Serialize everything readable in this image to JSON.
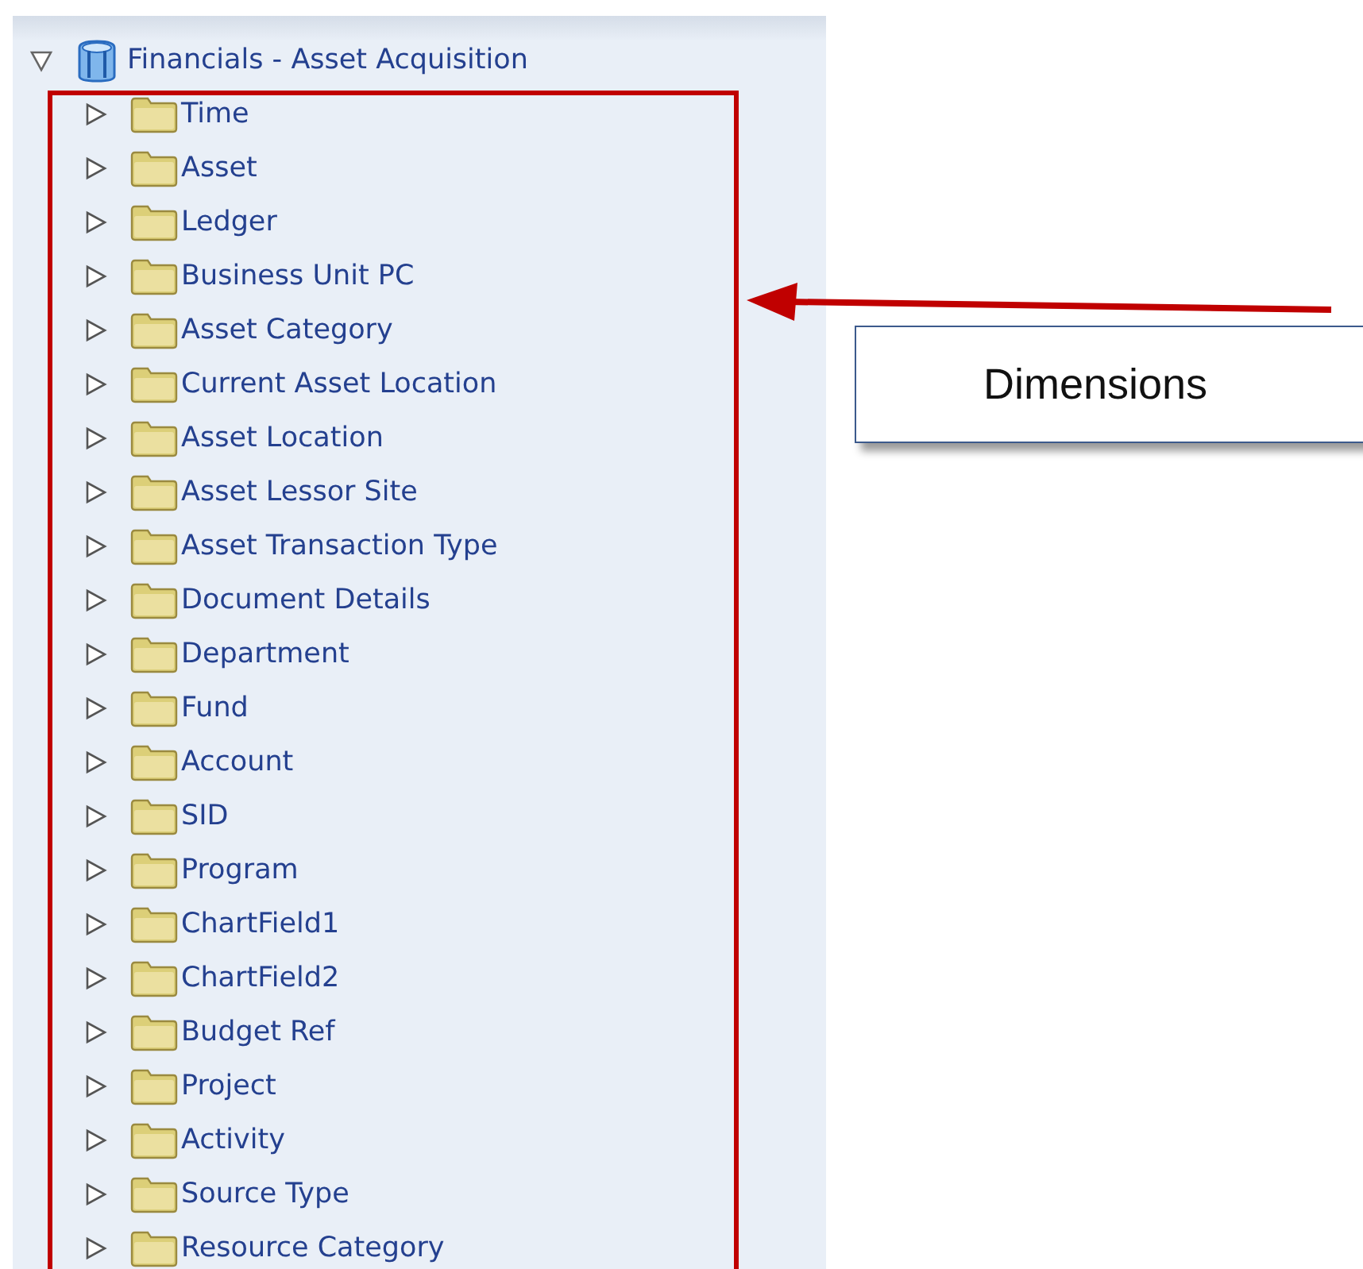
{
  "tree": {
    "label": "Financials - Asset Acquisition",
    "expanded": true,
    "children": [
      {
        "label": "Time",
        "expanded": false
      },
      {
        "label": "Asset",
        "expanded": false
      },
      {
        "label": "Ledger",
        "expanded": false
      },
      {
        "label": "Business Unit PC",
        "expanded": false
      },
      {
        "label": "Asset Category",
        "expanded": false
      },
      {
        "label": "Current Asset Location",
        "expanded": false
      },
      {
        "label": "Asset Location",
        "expanded": false
      },
      {
        "label": "Asset Lessor Site",
        "expanded": false
      },
      {
        "label": "Asset Transaction Type",
        "expanded": false
      },
      {
        "label": "Document Details",
        "expanded": false
      },
      {
        "label": "Department",
        "expanded": false
      },
      {
        "label": "Fund",
        "expanded": false
      },
      {
        "label": "Account",
        "expanded": false
      },
      {
        "label": "SID",
        "expanded": false
      },
      {
        "label": "Program",
        "expanded": false
      },
      {
        "label": "ChartField1",
        "expanded": false
      },
      {
        "label": "ChartField2",
        "expanded": false
      },
      {
        "label": "Budget Ref",
        "expanded": false
      },
      {
        "label": "Project",
        "expanded": false
      },
      {
        "label": "Activity",
        "expanded": false
      },
      {
        "label": "Source Type",
        "expanded": false
      },
      {
        "label": "Resource Category",
        "expanded": false
      }
    ]
  },
  "callout": {
    "text": "Dimensions"
  }
}
